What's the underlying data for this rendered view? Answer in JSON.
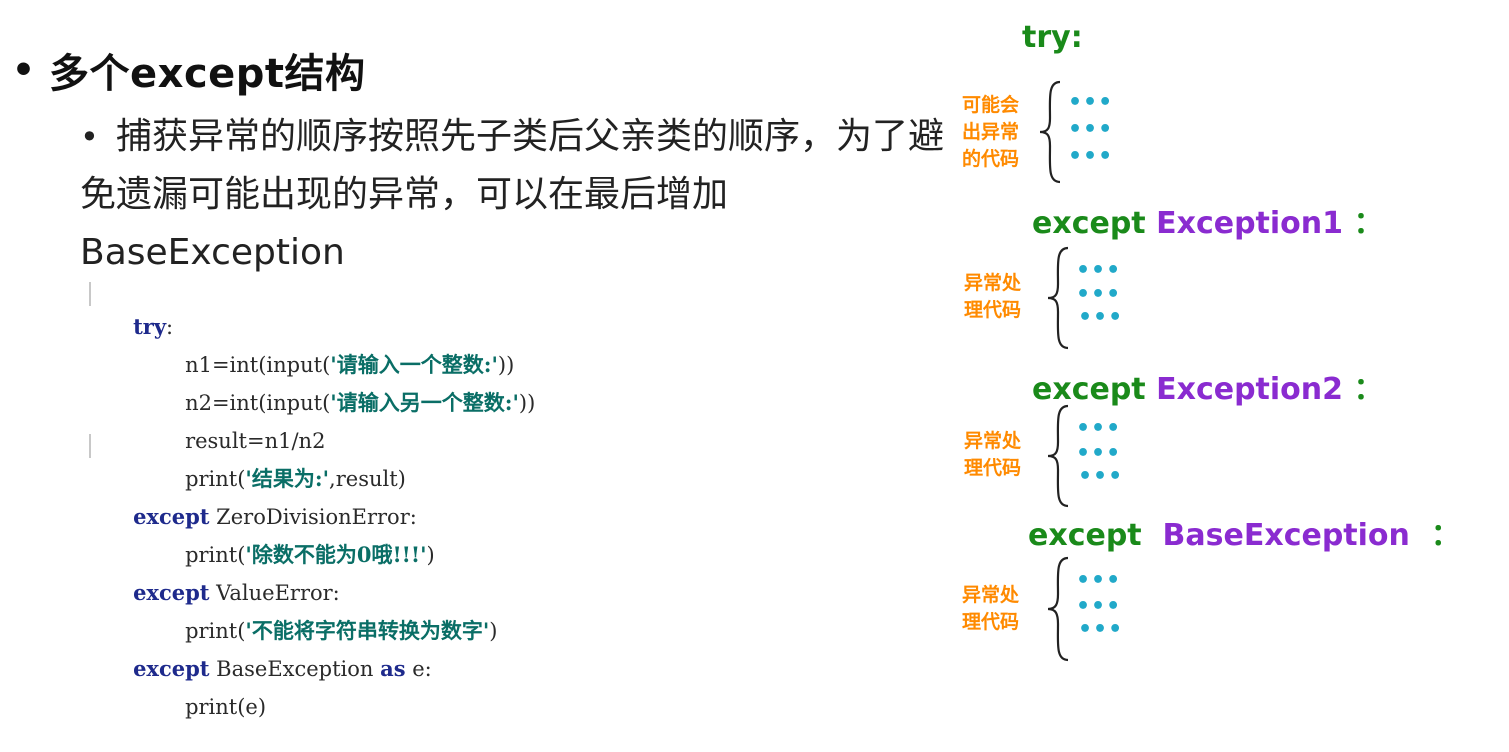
{
  "slide": {
    "title": "多个except结构",
    "subtitle": "捕获异常的顺序按照先子类后父亲类的顺序，为了避免遗漏可能出现的异常，可以在最后增加BaseException"
  },
  "code": {
    "lines": [
      {
        "kw": "try",
        "rest": ":"
      },
      {
        "a": "n1=int(input(",
        "s": "'请输入一个整数:'",
        "b": "))"
      },
      {
        "a": "n2=int(input(",
        "s": "'请输入另一个整数:'",
        "b": "))"
      },
      {
        "a": "result=n1/n2"
      },
      {
        "a": "print(",
        "s": "'结果为:'",
        "b": ",result)"
      },
      {
        "kw": "except",
        "rest": " ZeroDivisionError:"
      },
      {
        "a": "print(",
        "s": "'除数不能为0哦!!!'",
        "b": ")"
      },
      {
        "kw": "except",
        "rest": " ValueError:"
      },
      {
        "a": "print(",
        "s": "'不能将字符串转换为数字'",
        "b": ")"
      },
      {
        "kw": "except",
        "rest": " BaseException ",
        "kw2": "as",
        "rest2": " e:"
      },
      {
        "a": "print(e)"
      }
    ]
  },
  "diagram": {
    "try_label": "try:",
    "blocks": [
      {
        "label": [
          "可能会",
          "出异常",
          "的代码"
        ],
        "dots": [
          "•••",
          "•••",
          "•••"
        ]
      },
      {
        "keyword": "except",
        "exception": "Exception1",
        "colon": "：",
        "label": [
          "异常处",
          "理代码"
        ],
        "dots": [
          "•••",
          "•••",
          "•••"
        ]
      },
      {
        "keyword": "except",
        "exception": "Exception2",
        "colon": "：",
        "label": [
          "异常处",
          "理代码"
        ],
        "dots": [
          "•••",
          "•••",
          "•••"
        ]
      },
      {
        "keyword": "except",
        "exception": "BaseException",
        "colon": "：",
        "label": [
          "异常处",
          "理代码"
        ],
        "dots": [
          "•••",
          "•••",
          "•••"
        ]
      }
    ],
    "colors": {
      "keyword": "#1a8a1a",
      "exception": "#8a2bd0",
      "label": "#ff8a00",
      "dots": "#21a9c9"
    }
  }
}
